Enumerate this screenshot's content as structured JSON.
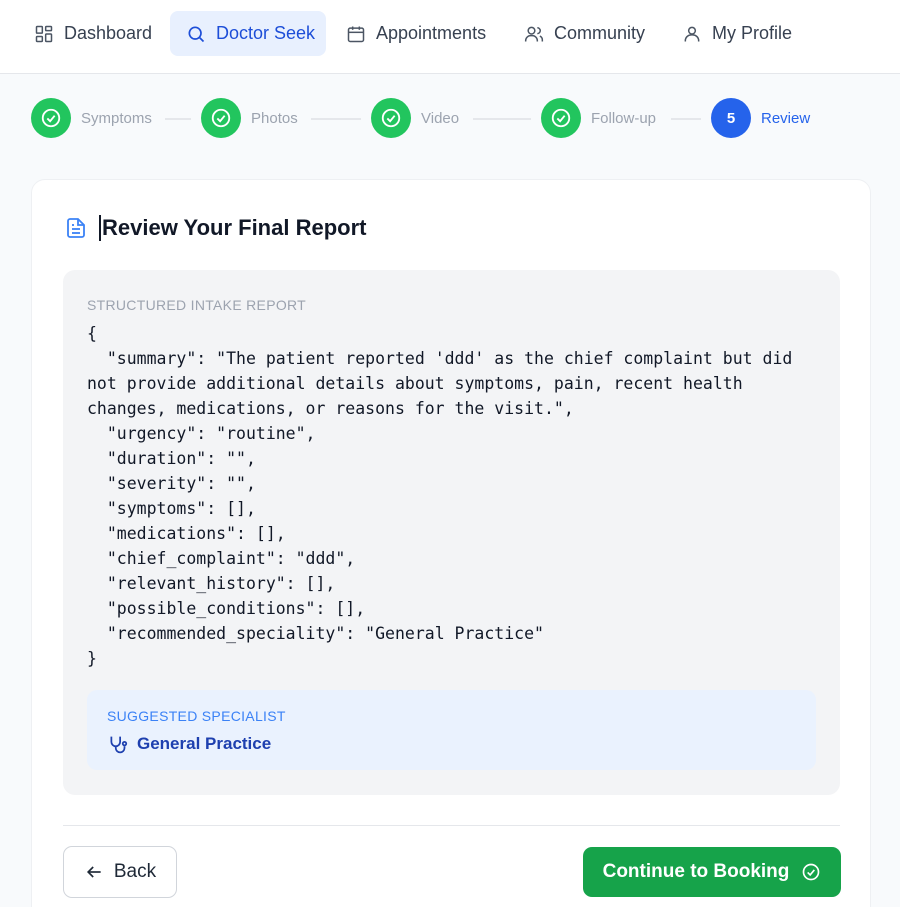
{
  "nav": {
    "items": [
      {
        "label": "Dashboard",
        "icon": "dashboard-icon"
      },
      {
        "label": "Doctor Seek",
        "icon": "search-icon",
        "active": true
      },
      {
        "label": "Appointments",
        "icon": "calendar-icon"
      },
      {
        "label": "Community",
        "icon": "users-icon"
      },
      {
        "label": "My Profile",
        "icon": "user-icon"
      }
    ]
  },
  "stepper": {
    "steps": [
      {
        "label": "Symptoms",
        "status": "done"
      },
      {
        "label": "Photos",
        "status": "done"
      },
      {
        "label": "Video",
        "status": "done"
      },
      {
        "label": "Follow-up",
        "status": "done"
      },
      {
        "label": "Review",
        "status": "current",
        "number": "5"
      }
    ]
  },
  "card": {
    "title": "Review Your Final Report",
    "report_heading": "STRUCTURED INTAKE REPORT",
    "report_json": "{\n  \"summary\": \"The patient reported 'ddd' as the chief complaint but did not provide additional details about symptoms, pain, recent health changes, medications, or reasons for the visit.\",\n  \"urgency\": \"routine\",\n  \"duration\": \"\",\n  \"severity\": \"\",\n  \"symptoms\": [],\n  \"medications\": [],\n  \"chief_complaint\": \"ddd\",\n  \"relevant_history\": [],\n  \"possible_conditions\": [],\n  \"recommended_speciality\": \"General Practice\"\n}",
    "specialist_label": "SUGGESTED SPECIALIST",
    "specialist_value": "General Practice"
  },
  "actions": {
    "back_label": "Back",
    "continue_label": "Continue to Booking"
  },
  "colors": {
    "primary": "#2563eb",
    "success": "#22c55e",
    "continue_button": "#16a34a",
    "specialist_bg": "#eaf2fe"
  }
}
